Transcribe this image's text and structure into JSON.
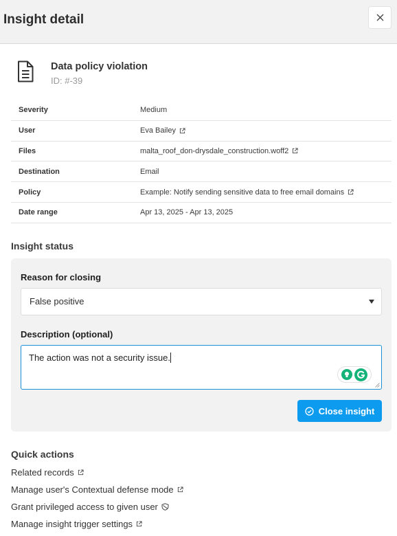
{
  "header": {
    "title": "Insight detail"
  },
  "insight": {
    "name": "Data policy violation",
    "id": "ID: #-39"
  },
  "details": [
    {
      "key": "Severity",
      "value": "Medium",
      "link": false
    },
    {
      "key": "User",
      "value": "Eva Bailey",
      "link": true
    },
    {
      "key": "Files",
      "value": "malta_roof_don-drysdale_construction.woff2",
      "link": true
    },
    {
      "key": "Destination",
      "value": "Email",
      "link": false
    },
    {
      "key": "Policy",
      "value": "Example: Notify sending sensitive data to free email domains",
      "link": true
    },
    {
      "key": "Date range",
      "value": "Apr 13, 2025 - Apr 13, 2025",
      "link": false
    }
  ],
  "status": {
    "title": "Insight status",
    "reason_label": "Reason for closing",
    "reason_value": "False positive",
    "description_label": "Description (optional)",
    "description_value": "The action was not a security issue.",
    "close_button": "Close insight"
  },
  "quick_actions": {
    "title": "Quick actions",
    "items": [
      {
        "label": "Related records",
        "icon": "external-link-icon"
      },
      {
        "label": "Manage user's Contextual defense mode",
        "icon": "external-link-icon"
      },
      {
        "label": "Grant privileged access to given user",
        "icon": "shield-icon"
      },
      {
        "label": "Manage insight trigger settings",
        "icon": "external-link-icon"
      }
    ]
  },
  "colors": {
    "primary": "#0d9bf0",
    "focus_border": "#1a8fd6",
    "panel_bg": "#f2f2f2",
    "grammarly": "#15b37a"
  }
}
